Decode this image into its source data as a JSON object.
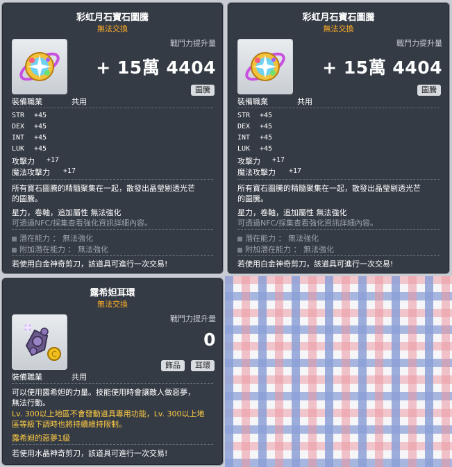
{
  "tooltips": [
    {
      "title": "彩虹月石寶石圖騰",
      "subtitle": "無法交換",
      "power_label": "戰鬥力提升量",
      "power_value": "+ 15萬 4404",
      "tags": [
        "圖騰"
      ],
      "job_label": "裝備職業",
      "job_value": "共用",
      "stats": [
        {
          "name": "STR",
          "value": "+45"
        },
        {
          "name": "DEX",
          "value": "+45"
        },
        {
          "name": "INT",
          "value": "+45"
        },
        {
          "name": "LUK",
          "value": "+45"
        },
        {
          "name": "攻擊力",
          "value": "+17"
        },
        {
          "name": "魔法攻擊力",
          "value": "+17"
        }
      ],
      "desc1": "所有寶石圖騰的精髓聚集在一起，散發出晶瑩剔透光芒",
      "desc2": "的圖騰。",
      "star_line": "星力，卷軸，追加屬性 無法強化",
      "nfc_line": "可透過NFC/採集查看強化資訊詳細內容。",
      "potential": "潛在能力 ： 無法強化",
      "bonus_potential": "附加潛在能力 ： 無法強化",
      "footer": "若使用白金神奇剪刀，該道具可進行一次交易!"
    },
    {
      "title": "彩虹月石寶石圖騰",
      "subtitle": "無法交換",
      "power_label": "戰鬥力提升量",
      "power_value": "+ 15萬 4404",
      "tags": [
        "圖騰"
      ],
      "job_label": "裝備職業",
      "job_value": "共用",
      "stats": [
        {
          "name": "STR",
          "value": "+45"
        },
        {
          "name": "DEX",
          "value": "+45"
        },
        {
          "name": "INT",
          "value": "+45"
        },
        {
          "name": "LUK",
          "value": "+45"
        },
        {
          "name": "攻擊力",
          "value": "+17"
        },
        {
          "name": "魔法攻擊力",
          "value": "+17"
        }
      ],
      "desc1": "所有寶石圖騰的精髓聚集在一起，散發出晶瑩剔透光芒",
      "desc2": "的圖騰。",
      "star_line": "星力，卷軸，追加屬性 無法強化",
      "nfc_line": "可透過NFC/採集查看強化資訊詳細內容。",
      "potential": "潛在能力 ： 無法強化",
      "bonus_potential": "附加潛在能力 ： 無法強化",
      "footer": "若使用白金神奇剪刀，該道具可進行一次交易!"
    },
    {
      "title": "露希妲耳環",
      "subtitle": "無法交換",
      "power_label": "戰鬥力提升量",
      "power_value": "0",
      "tags": [
        "飾品",
        "耳環"
      ],
      "job_label": "裝備職業",
      "job_value": "共用",
      "desc1": "可以使用露希妲的力量。技能使用時會讓敵人做惡夢，",
      "desc2": "無法行動。",
      "lv_line1": "Lv. 300以上地區不會發動道具專用功能，Lv. 300以上地",
      "lv_line2": "區等級下調時也將持續維持限制。",
      "nightmare": "露希妲的惡夢1級",
      "footer": "若使用水晶神奇剪刀，該道具可進行一次交易!"
    }
  ]
}
